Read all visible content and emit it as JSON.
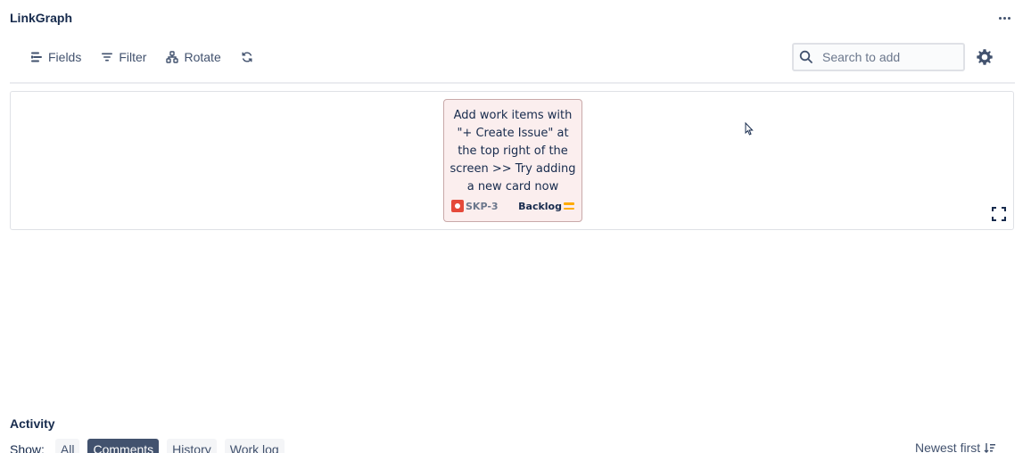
{
  "header": {
    "title": "LinkGraph"
  },
  "toolbar": {
    "fields_label": "Fields",
    "filter_label": "Filter",
    "rotate_label": "Rotate"
  },
  "search": {
    "placeholder": "Search to add"
  },
  "card": {
    "text": "Add work items with \"+ Create Issue\" at the top right of the screen >> Try adding a new card now",
    "key": "SKP-3",
    "status": "Backlog",
    "issue_type_icon": "bug-icon",
    "priority_icon": "priority-medium-icon",
    "colors": {
      "background": "#fbeeee",
      "issue_type": "#e5493a",
      "priority": "#ffab00"
    }
  },
  "activity": {
    "title": "Activity",
    "show_label": "Show:",
    "filters": [
      {
        "label": "All",
        "active": false
      },
      {
        "label": "Comments",
        "active": true
      },
      {
        "label": "History",
        "active": false
      },
      {
        "label": "Work log",
        "active": false
      }
    ],
    "sort_label": "Newest first"
  }
}
